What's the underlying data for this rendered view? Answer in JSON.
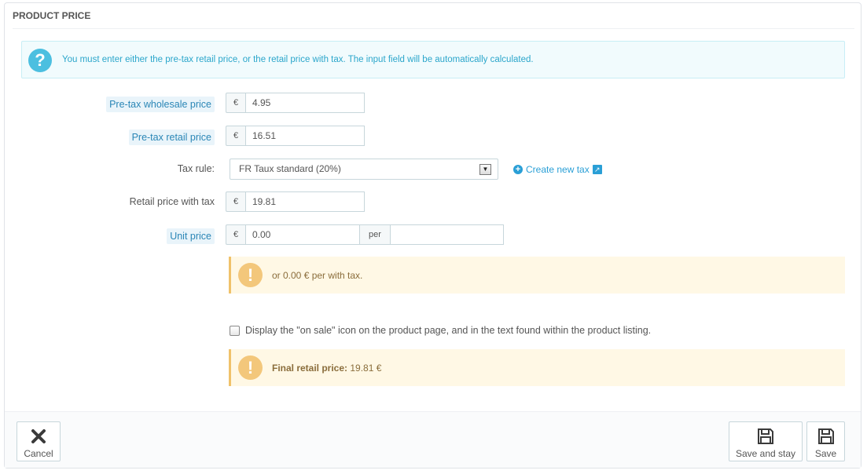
{
  "panel": {
    "title": "PRODUCT PRICE"
  },
  "info_alert": {
    "icon": "question-icon",
    "text": "You must enter either the pre-tax retail price, or the retail price with tax. The input field will be automatically calculated."
  },
  "wholesale": {
    "label": "Pre-tax wholesale price",
    "currency": "€",
    "value": "4.95"
  },
  "retail": {
    "label": "Pre-tax retail price",
    "currency": "€",
    "value": "16.51"
  },
  "tax_rule": {
    "label": "Tax rule:",
    "selected": "FR Taux standard (20%)",
    "create_link": "Create new tax"
  },
  "retail_with_tax": {
    "label": "Retail price with tax",
    "currency": "€",
    "value": "19.81"
  },
  "unit_price": {
    "label": "Unit price",
    "currency": "€",
    "value": "0.00",
    "per_label": "per",
    "per_value": ""
  },
  "unit_alert": {
    "text": "or 0.00 € per with tax."
  },
  "on_sale": {
    "checked": false,
    "text": "Display the \"on sale\" icon on the product page, and in the text found within the product listing."
  },
  "final_alert": {
    "label": "Final retail price:",
    "value": "19.81 €"
  },
  "footer": {
    "cancel_label": "Cancel",
    "save_stay_label": "Save and stay",
    "save_label": "Save"
  },
  "colors": {
    "accent": "#2a9fd6",
    "info_bg": "#f1fbfd",
    "warn_bg": "#fff8e5",
    "warn_icon": "#f3c77b"
  }
}
